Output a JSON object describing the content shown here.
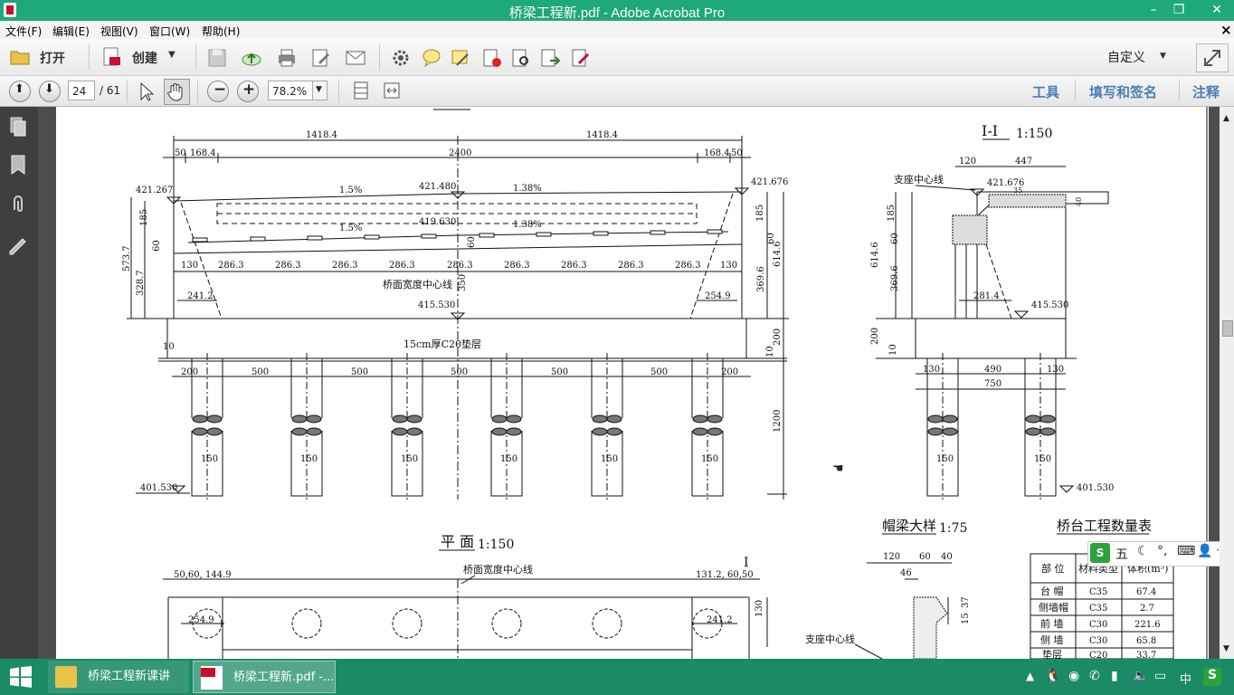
{
  "window": {
    "title": "桥梁工程新.pdf - Adobe Acrobat Pro",
    "minimize": "–",
    "restore": "❐",
    "close": "✕"
  },
  "menu": [
    {
      "label": "文件(F)"
    },
    {
      "label": "编辑(E)"
    },
    {
      "label": "视图(V)"
    },
    {
      "label": "窗口(W)"
    },
    {
      "label": "帮助(H)"
    }
  ],
  "menu_close": "×",
  "toolbar": {
    "open": "打开",
    "create": "创建",
    "customize": "自定义"
  },
  "nav": {
    "page_current": "24",
    "page_total": "/ 61",
    "zoom": "78.2%"
  },
  "right_links": {
    "tools": "工具",
    "fill_sign": "填写和签名",
    "comment": "注释"
  },
  "drawing": {
    "elev": {
      "dim_total_left": "1418.4",
      "dim_total_right": "1418.4",
      "dim_50a": "50",
      "dim_168a": "168.4",
      "dim_2400": "2400",
      "dim_168b": "168.4",
      "dim_50b": "50",
      "elev_left": "421.267",
      "elev_mid": "421.480",
      "elev_right": "421.676",
      "slope_left": "1.5%",
      "slope_right": "1.38%",
      "slope_left2": "1.5%",
      "slope_right2": "1.38%",
      "elev_inner": "419.630",
      "dim_60": "60",
      "spans": [
        "130",
        "286.3",
        "286.3",
        "286.3",
        "286.3",
        "286.3",
        "286.3",
        "286.3",
        "286.3",
        "286.3",
        "130"
      ],
      "h_185": "185",
      "h_60": "60",
      "h_5737": "573.7",
      "h_3287": "328.7",
      "h_185r": "185",
      "h_60r": "60",
      "h_6146": "614.6",
      "h_3696": "369.6",
      "left_241": "241.2",
      "right_254": "254.9",
      "centerline": "桥面宽度中心线",
      "dim_350": "350",
      "elev_base": "415.530",
      "cushion": "15cm厚C20垫层",
      "dim_10": "10",
      "dim_200r": "200",
      "dim_10r": "10",
      "pile_spacing": [
        "200",
        "500",
        "500",
        "500",
        "500",
        "500",
        "200"
      ],
      "pile_dia": [
        "150",
        "150",
        "150",
        "150",
        "150",
        "150"
      ],
      "pile_len": "1200",
      "elev_bottom": "401.530"
    },
    "section": {
      "title": "I-I",
      "scale": "1:150",
      "dim_120": "120",
      "dim_447": "447",
      "support_line": "支座中心线",
      "elev_top": "421.676",
      "dim_35": "35",
      "dim_40": "40",
      "h_185": "185",
      "h_60": "60",
      "h_6146": "614.6",
      "h_3696": "369.6",
      "dim_2814": "281.4",
      "elev_base": "415.530",
      "h_200": "200",
      "h_10": "10",
      "dim_130a": "130",
      "dim_490": "490",
      "dim_130b": "130",
      "dim_750": "750",
      "pile_dia": [
        "150",
        "150"
      ],
      "elev_bottom": "401.530"
    },
    "plan": {
      "title": "平 面",
      "scale": "1:150",
      "centerline": "桥面宽度中心线",
      "dim_left": "50,60, 144.9",
      "dim_right": "131.2, 60,50",
      "mark_I": "I",
      "left_2549": "254.9",
      "right_2412": "241.2",
      "dim_130": "130"
    },
    "cap": {
      "title": "帽梁大样",
      "scale": "1:75",
      "dim_120": "120",
      "dim_60": "60",
      "dim_40": "40",
      "dim_46": "46",
      "dim_37": "37",
      "dim_15": "15",
      "support_line": "支座中心线"
    },
    "table": {
      "title": "桥台工程数量表",
      "headers": [
        "部 位",
        "材料类型",
        "体积(m³)"
      ],
      "rows": [
        [
          "台 帽",
          "C35",
          "67.4"
        ],
        [
          "侧墙帽",
          "C35",
          "2.7"
        ],
        [
          "前 墙",
          "C30",
          "221.6"
        ],
        [
          "侧 墙",
          "C30",
          "65.8"
        ],
        [
          "垫层",
          "C20",
          "33.7"
        ]
      ]
    }
  },
  "ime": {
    "label": "五"
  },
  "taskbar": {
    "items": [
      {
        "label": "桥梁工程新课讲"
      },
      {
        "label": "桥梁工程新.pdf -..."
      }
    ],
    "lang": "中"
  }
}
